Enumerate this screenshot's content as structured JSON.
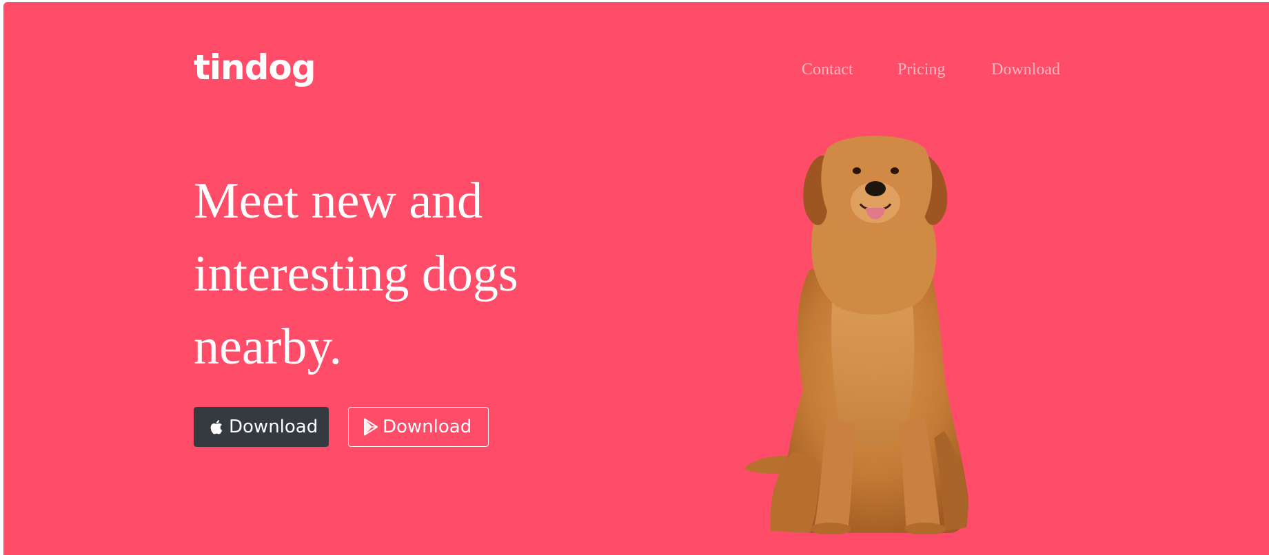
{
  "navbar": {
    "brand": "tindog",
    "links": [
      "Contact",
      "Pricing",
      "Download"
    ]
  },
  "hero": {
    "headline_lines": [
      "Meet new and",
      "interesting dogs",
      "nearby."
    ],
    "buttons": [
      {
        "label": "Download",
        "icon": "apple-icon",
        "style": "dark"
      },
      {
        "label": "Download",
        "icon": "google-play-icon",
        "style": "outline"
      }
    ],
    "image": "golden-retriever-dog"
  },
  "colors": {
    "background": "#ff4c68",
    "button_dark": "#343a40",
    "text": "#ffffff"
  }
}
